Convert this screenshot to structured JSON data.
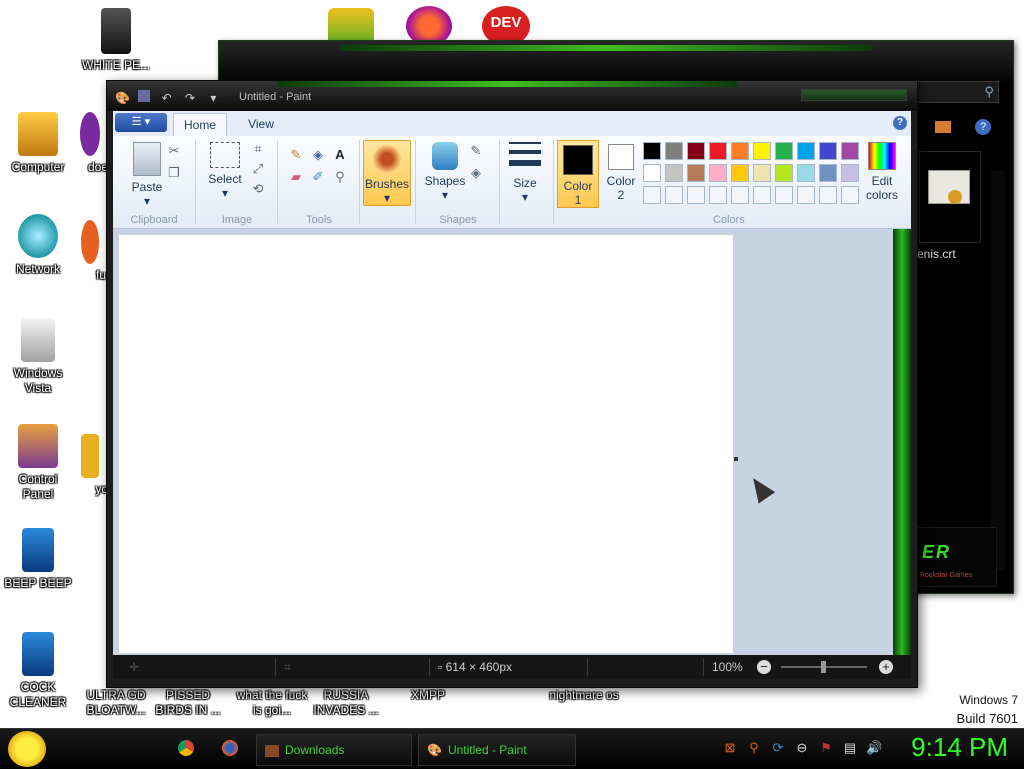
{
  "desktop": {
    "icons": [
      {
        "label": "WHITE PE..."
      },
      {
        "label": "Computer"
      },
      {
        "label": "Network"
      },
      {
        "label": "Windows Vista"
      },
      {
        "label": "Control Panel"
      },
      {
        "label": "BEEP BEEP"
      },
      {
        "label": "COCK CLEANER"
      },
      {
        "label": "doe"
      },
      {
        "label": "fu"
      },
      {
        "label": "yo"
      },
      {
        "label": "ULTRA GD BLOATW..."
      },
      {
        "label": "PISSED BIRDS IN ..."
      },
      {
        "label": "what the fuck is goi..."
      },
      {
        "label": "RUSSIA INVADES ..."
      },
      {
        "label": "XMPP"
      },
      {
        "label": "nightmare os"
      }
    ],
    "top_apps": [
      "angry-birds-icon",
      "pinball-icon",
      "dev-cpp-icon"
    ],
    "windows_version": "Windows 7",
    "build": "Build 7601"
  },
  "background_window": {
    "file_label": "enis.crt",
    "logo_text": "ER",
    "logo_sub": "Rockstar Games"
  },
  "paint": {
    "title": "Untitled - Paint",
    "tabs": {
      "file": "",
      "home": "Home",
      "view": "View"
    },
    "clipboard": {
      "paste": "Paste",
      "group": "Clipboard"
    },
    "image": {
      "select": "Select",
      "group": "Image"
    },
    "tools": {
      "group": "Tools"
    },
    "brushes": {
      "label": "Brushes"
    },
    "shapes": {
      "label": "Shapes",
      "group": "Shapes"
    },
    "size": {
      "label": "Size"
    },
    "color1": {
      "line1": "Color",
      "line2": "1",
      "value": "#000000"
    },
    "color2": {
      "line1": "Color",
      "line2": "2",
      "value": "#ffffff"
    },
    "edit_colors": {
      "line1": "Edit",
      "line2": "colors"
    },
    "colors_group": "Colors",
    "palette_row1": [
      "#000000",
      "#7f7f7f",
      "#880015",
      "#ed1c24",
      "#ff7f27",
      "#fff200",
      "#22b14c",
      "#00a2e8",
      "#3f48cc",
      "#a349a4"
    ],
    "palette_row2": [
      "#ffffff",
      "#c3c3c3",
      "#b97a57",
      "#ffaec9",
      "#ffc90e",
      "#efe4b0",
      "#b5e61d",
      "#99d9ea",
      "#7092be",
      "#c8bfe7"
    ],
    "status": {
      "dimensions": "614 × 460px",
      "zoom": "100%"
    }
  },
  "taskbar": {
    "items": [
      {
        "label": "Downloads"
      },
      {
        "label": "Untitled - Paint"
      }
    ],
    "clock": "9:14 PM"
  }
}
